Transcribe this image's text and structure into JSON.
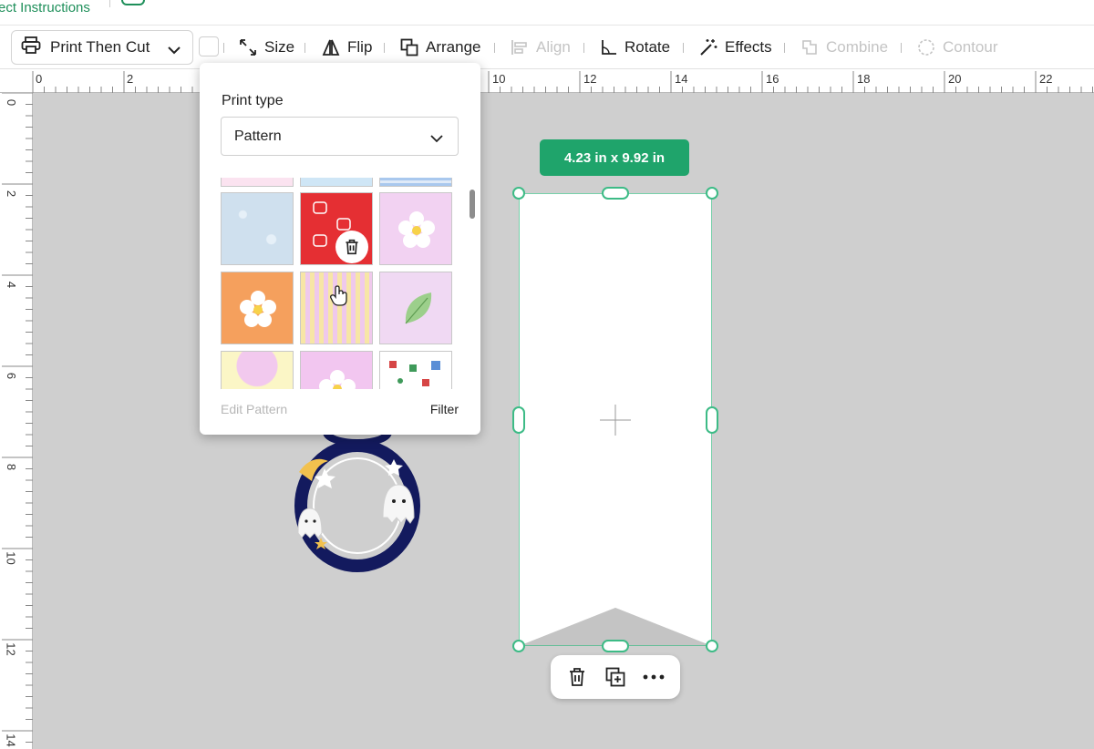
{
  "top_strip": {
    "link_text": "ect Instructions"
  },
  "toolbar": {
    "print_mode": "Print Then Cut",
    "size": "Size",
    "flip": "Flip",
    "arrange": "Arrange",
    "align": "Align",
    "rotate": "Rotate",
    "effects": "Effects",
    "combine": "Combine",
    "contour": "Contour"
  },
  "ruler": {
    "horizontal": [
      "0",
      "2",
      "10",
      "12",
      "14",
      "16",
      "18",
      "20",
      "22"
    ],
    "vertical": [
      "0",
      "2",
      "4",
      "6",
      "8",
      "10",
      "12",
      "14"
    ]
  },
  "selection": {
    "dimensions": "4.23  in x 9.92  in"
  },
  "print_panel": {
    "title": "Print type",
    "selected_type": "Pattern",
    "edit_label": "Edit Pattern",
    "filter_label": "Filter"
  },
  "colors": {
    "accent": "#1fa46b",
    "handle": "#3dbb86",
    "canvas": "#cfcfcf",
    "ghost_ring": "#131a5e"
  }
}
